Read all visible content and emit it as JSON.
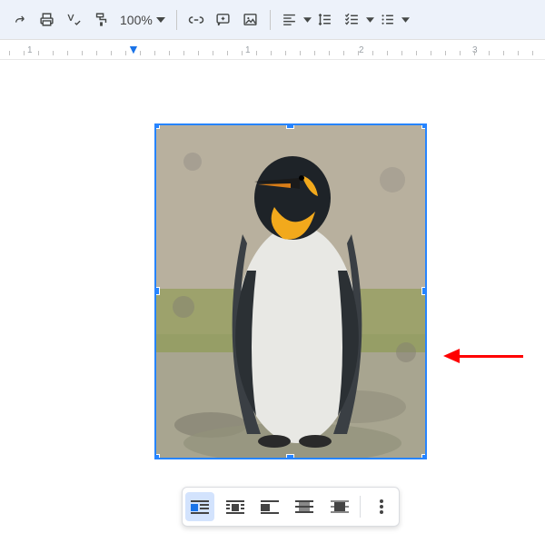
{
  "toolbar": {
    "zoom": "100%",
    "icons": {
      "redo": "redo-icon",
      "print": "print-icon",
      "spellcheck": "spellcheck-icon",
      "paint_format": "paint-format-icon",
      "link": "link-icon",
      "comment": "comment-icon",
      "image": "image-icon",
      "align": "align-icon",
      "line_spacing": "line-spacing-icon",
      "checklist": "checklist-icon",
      "bullets": "bullets-icon"
    }
  },
  "ruler": {
    "labels": [
      "1",
      "1",
      "2",
      "3"
    ],
    "positions": [
      30,
      270,
      395,
      520
    ]
  },
  "image": {
    "subject": "penguin",
    "selected": true,
    "handles": 8
  },
  "image_toolbar": {
    "options": [
      "in-line",
      "wrap-text",
      "break-text-left",
      "break-text-center",
      "behind-text"
    ],
    "selected": "in-line",
    "more": "more-options"
  },
  "annotation": {
    "arrow_color": "#ff0000",
    "points_to": "right-resize-handle"
  },
  "colors": {
    "selection": "#2684ff",
    "toolbar_bg": "#edf2fa",
    "active_option": "#d3e3fd"
  }
}
